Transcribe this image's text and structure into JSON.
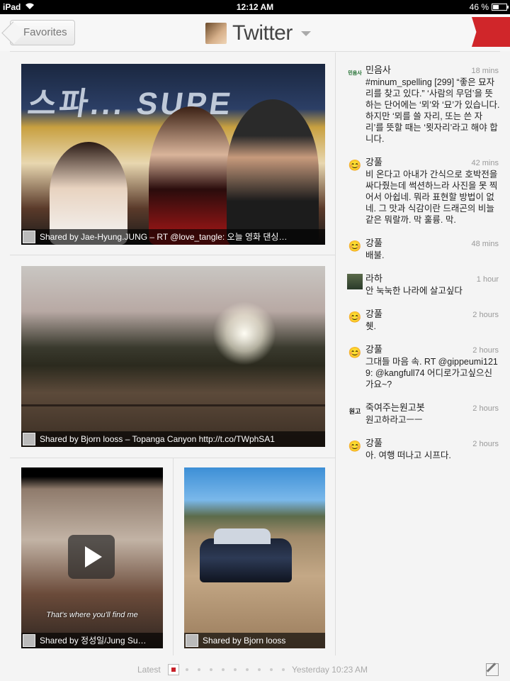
{
  "status_bar": {
    "device": "iPad",
    "wifi_icon": "wifi-icon",
    "time": "12:12 AM",
    "battery_text": "46 %",
    "battery_level": 0.46
  },
  "header": {
    "back_label": "Favorites",
    "title": "Twitter",
    "ribbon_color": "#d0262a"
  },
  "photos": [
    {
      "caption": "Shared by Jae-Hyung.JUNG – RT @love_tangle: 오늘 영화 댄싱…",
      "stage_text": "스파... SUPE"
    },
    {
      "caption": "Shared by Bjorn looss  –  Topanga Canyon  http://t.co/TWphSA1"
    },
    {
      "caption": "Shared by 정성일/Jung Su…",
      "subtitle": "That's where you'll find me"
    },
    {
      "caption": "Shared by Bjorn looss"
    }
  ],
  "tweets": [
    {
      "name": "민음사",
      "time": "18 mins",
      "text": "#minum_spelling [299] “좋은 묘자리를 찾고 있다.” ‘사람의 무덤’을 뜻하는 단어에는 ‘뫼’와 ‘묘’가 있습니다. 하지만 ‘뫼를 쓸 자리, 또는 쓴 자리’를 뜻할 때는 ‘묏자리’라고 해야 합니다.",
      "avatar": "민음사"
    },
    {
      "name": "강풀",
      "time": "42 mins",
      "text": "비 온다고 아내가 간식으로 호박전을 싸다줬는데 썩션하느라 사진을 못 찍어서 아쉽네. 뭐라 표현할 방법이 없네. 그 맛과 식감이란 드래곤의 비늘같은 뭐랄까. 막 훌륭. 막.",
      "avatar": "😊"
    },
    {
      "name": "강풀",
      "time": "48 mins",
      "text": "배불.",
      "avatar": "😊"
    },
    {
      "name": "라하",
      "time": "1 hour",
      "text": "안 눅눅한 나라에 살고싶다",
      "avatar": ""
    },
    {
      "name": "강풀",
      "time": "2 hours",
      "text": "췟.",
      "avatar": "😊"
    },
    {
      "name": "강풀",
      "time": "2 hours",
      "text": "그대들 마음 속. RT @gippeumi1219: @kangfull74 어디로가고싶으신가요~?",
      "avatar": "😊"
    },
    {
      "name": "죽여주는원고봇",
      "time": "2 hours",
      "text": "원고하라고ㅡㅡ",
      "avatar": "원고"
    },
    {
      "name": "강풀",
      "time": "2 hours",
      "text": "아. 여행 떠나고 시프다.",
      "avatar": "😊"
    }
  ],
  "footer": {
    "latest_label": "Latest",
    "time_label": "Yesterday 10:23 AM",
    "compose_icon": "compose-icon",
    "accent": "#c8222a"
  }
}
